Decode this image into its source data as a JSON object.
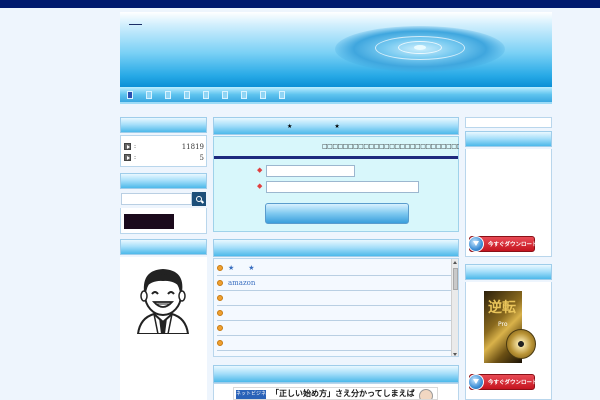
{
  "header": {
    "site_title": ""
  },
  "nav": {
    "items": [
      "",
      "",
      "",
      "",
      "",
      "",
      "",
      "",
      ""
    ],
    "active_index": 0
  },
  "sidebar_left": {
    "counter": [
      {
        "label": ":",
        "value": "11819"
      },
      {
        "label": ":",
        "value": "5"
      }
    ],
    "search": {
      "placeholder": ""
    }
  },
  "main": {
    "panel_title": "★　　　　　　　★",
    "form_text": "□□□□□□□□□□□□□□□□□□□□□□□□□□□□□□□□□□□□□",
    "required_mark": "◆",
    "submit_label": "",
    "list": [
      "★　　★",
      "amazon",
      "",
      "",
      "",
      ""
    ]
  },
  "banner": {
    "tag": "ネットビジネス",
    "text": "「正しい始め方」さえ分かってしまえば"
  },
  "sidebar_right": {
    "download_label": "今すぐダウンロード",
    "product_title": "逆転",
    "product_sub": "Pro"
  },
  "colors": {
    "topbar": "#001a6e",
    "accent": "#27a9e6",
    "link": "#3a6fc0",
    "download": "#c5141f"
  }
}
